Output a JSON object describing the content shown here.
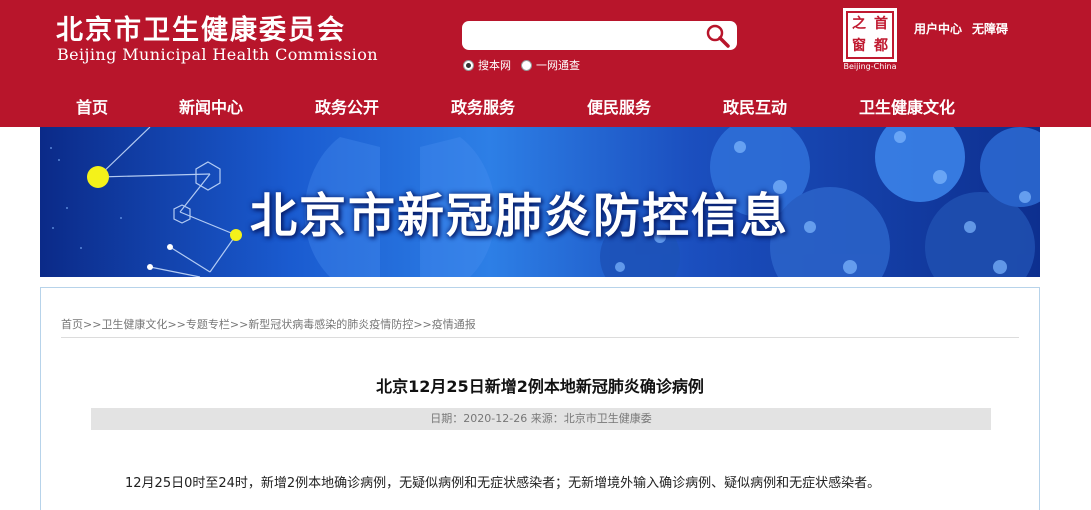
{
  "header": {
    "title_cn": "北京市卫生健康委员会",
    "title_en": "Beijing Municipal Health Commission",
    "search": {
      "placeholder": "",
      "value": ""
    },
    "search_scope": [
      {
        "label": "搜本网",
        "checked": true
      },
      {
        "label": "一网通查",
        "checked": false
      }
    ],
    "seal": {
      "chars": [
        "之",
        "首",
        "窗",
        "都"
      ],
      "caption": "Beijing-China"
    },
    "links": {
      "user_center": "用户中心",
      "accessibility": "无障碍"
    },
    "brand_color": "#b8152b"
  },
  "nav": {
    "items": [
      "首页",
      "新闻中心",
      "政务公开",
      "政务服务",
      "便民服务",
      "政民互动",
      "卫生健康文化"
    ]
  },
  "banner": {
    "title": "北京市新冠肺炎防控信息"
  },
  "breadcrumb": [
    "首页",
    "卫生健康文化",
    "专题专栏",
    "新型冠状病毒感染的肺炎疫情防控",
    "疫情通报"
  ],
  "article": {
    "title": "北京12月25日新增2例本地新冠肺炎确诊病例",
    "meta": "日期：2020-12-26 来源：北京市卫生健康委",
    "body": "12月25日0时至24时，新增2例本地确诊病例，无疑似病例和无症状感染者；无新增境外输入确诊病例、疑似病例和无症状感染者。"
  }
}
